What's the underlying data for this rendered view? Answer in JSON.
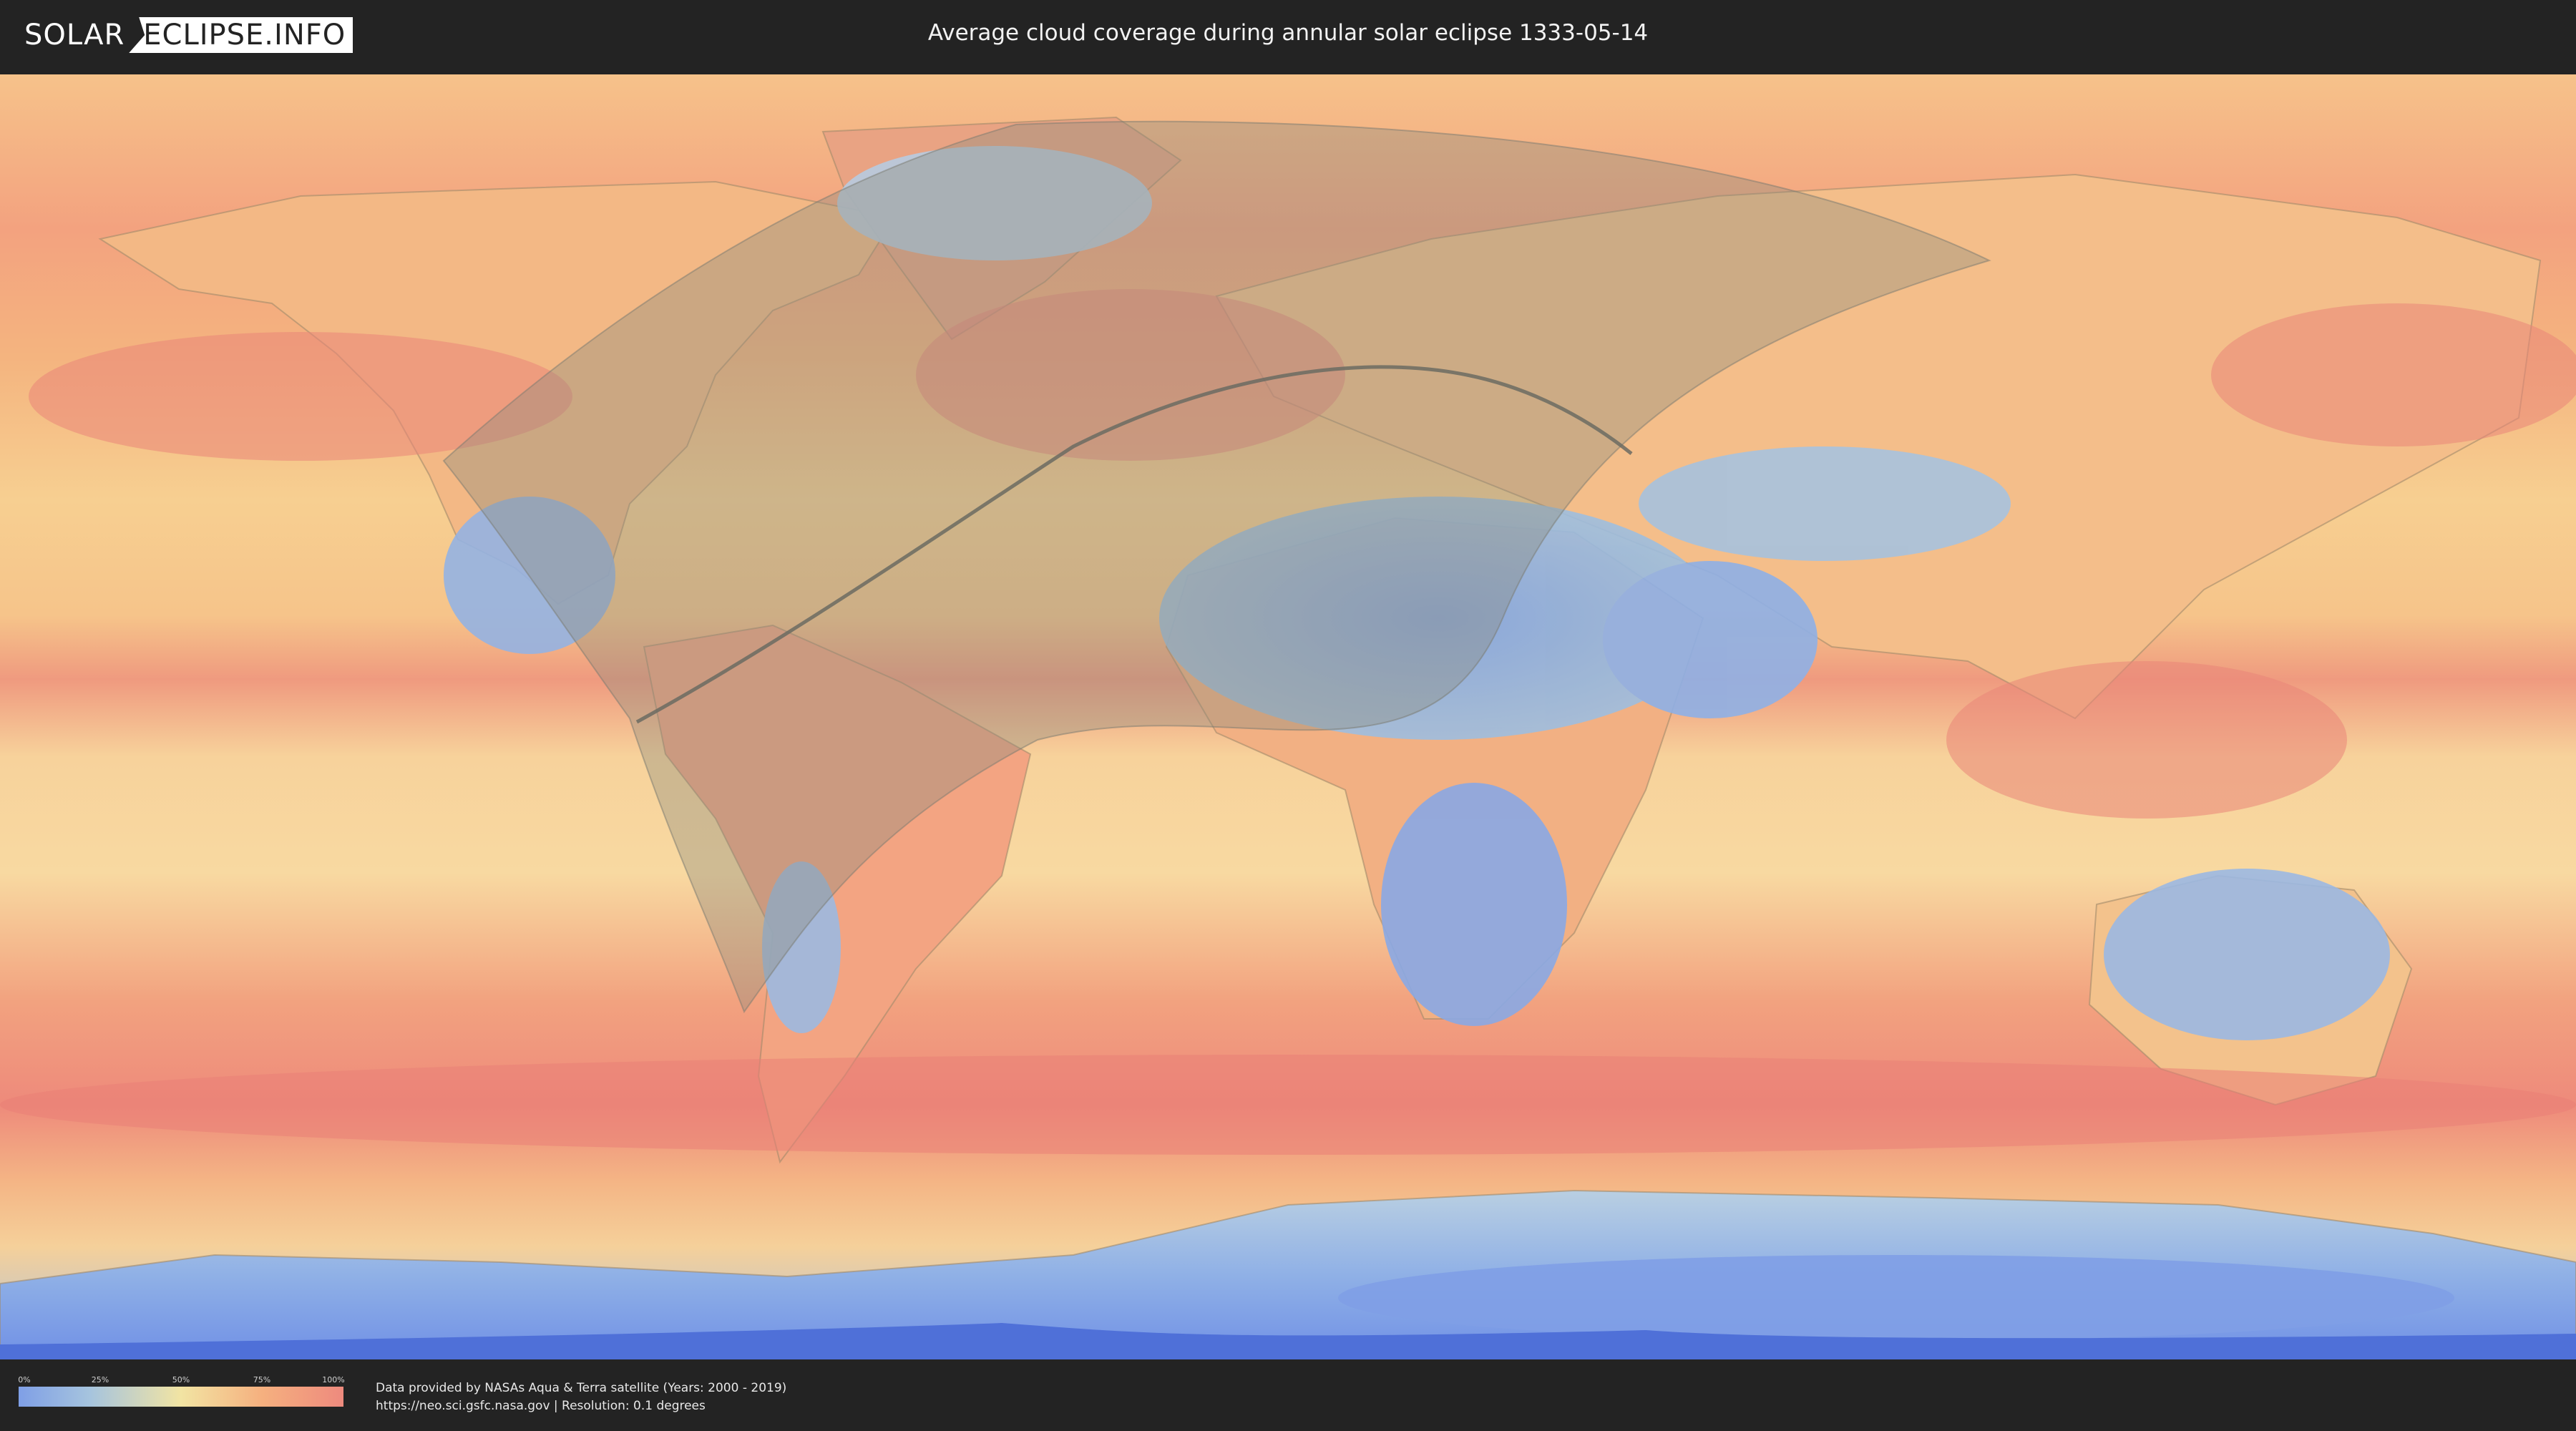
{
  "header": {
    "logo_left": "SOLAR",
    "logo_right": "ECLIPSE.INFO",
    "title": "Average cloud coverage during annular solar eclipse 1333-05-14"
  },
  "legend": {
    "ticks": [
      "0%",
      "25%",
      "50%",
      "75%",
      "100%"
    ],
    "colors": {
      "clear": "#7f9fe6",
      "low": "#a6c4de",
      "mid": "#f2e4a3",
      "high": "#f5b07f",
      "overcast": "#ee8a7e"
    }
  },
  "credits": {
    "line1": "Data provided by NASAs Aqua & Terra satellite (Years: 2000 - 2019)",
    "line2": "https://neo.sci.gsfc.nasa.gov | Resolution: 0.1 degrees"
  }
}
